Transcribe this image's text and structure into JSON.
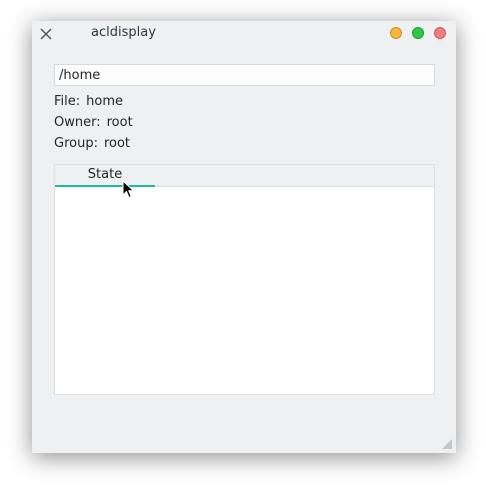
{
  "window": {
    "title": "acldisplay",
    "icon": "x-icon",
    "controls": [
      "minimize",
      "maximize",
      "close"
    ],
    "colors": {
      "minimize": "#f6b73c",
      "maximize": "#33c748",
      "close": "#f17f7f"
    }
  },
  "path_field": {
    "value": "/home"
  },
  "info": {
    "file_label": "File:",
    "file_value": "home",
    "owner_label": "Owner:",
    "owner_value": "root",
    "group_label": "Group:",
    "group_value": "root"
  },
  "tabs": [
    {
      "label": "State",
      "active": true
    }
  ],
  "accent_color": "#1abc9c"
}
